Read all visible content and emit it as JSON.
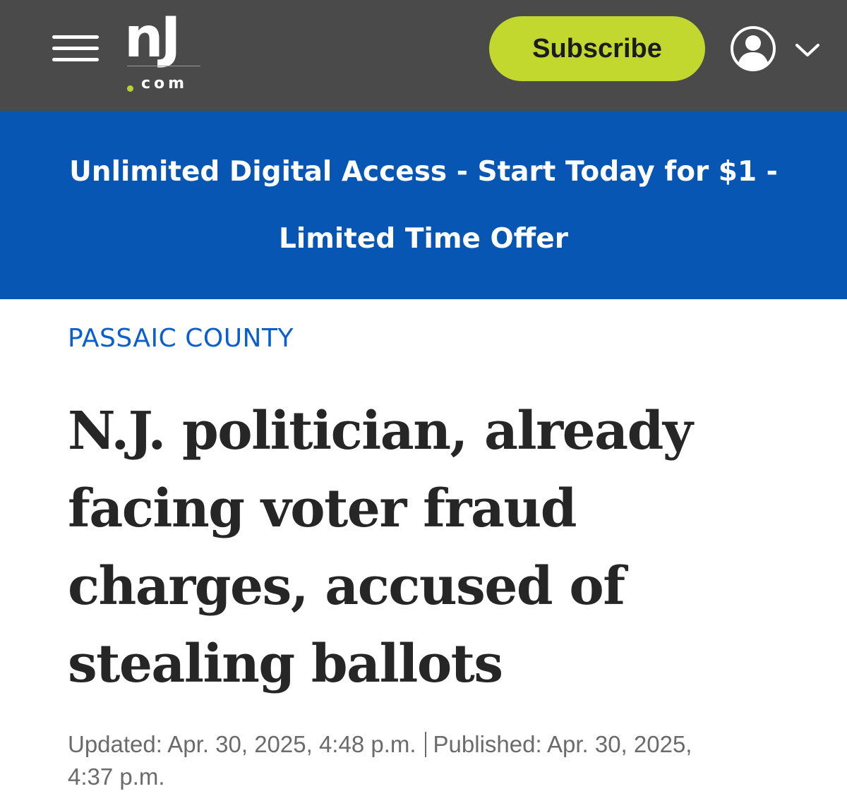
{
  "header": {
    "logo": {
      "wordmark": "nJ",
      "suffix": "com",
      "dot_color": "#b5d334"
    },
    "menu_icon": "hamburger-menu-icon",
    "subscribe_label": "Subscribe",
    "user_icon": "user-account-icon",
    "dropdown_icon": "chevron-down-icon",
    "background_color": "#4a4a4a",
    "subscribe_color": "#c3d82e"
  },
  "promo_banner": {
    "line1": "Unlimited Digital Access - Start Today for $1 -",
    "line2": "Limited Time Offer",
    "background_color": "#0756b3"
  },
  "article": {
    "section": "PASSAIC COUNTY",
    "section_color": "#0a5fcf",
    "headline_lines": [
      "N.J. politician, already",
      "facing voter fraud",
      "charges, accused of",
      "stealing ballots"
    ],
    "updated": "Updated: Apr. 30, 2025, 4:48 p.m.",
    "published_line1": "Published: Apr. 30, 2025,",
    "published_line2": "4:37 p.m."
  }
}
